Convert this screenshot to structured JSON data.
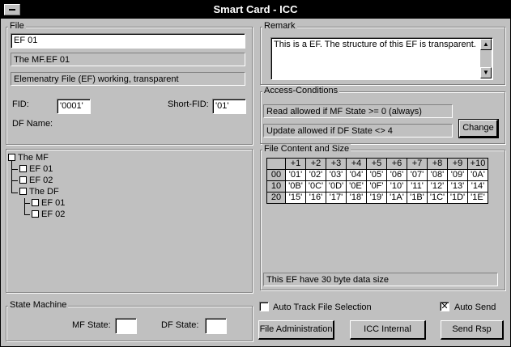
{
  "window": {
    "title": "Smart Card - ICC"
  },
  "file": {
    "group_label": "File",
    "name_value": "EF 01",
    "path": "The MF.EF 01",
    "type": "Elemenatry File (EF) working, transparent",
    "fid_label": "FID:",
    "fid_value": "'0001'",
    "short_fid_label": "Short-FID:",
    "short_fid_value": "'01'",
    "df_name_label": "DF Name:"
  },
  "remark": {
    "group_label": "Remark",
    "text": "This is a EF. The structure of this EF is transparent."
  },
  "access": {
    "group_label": "Access-Conditions",
    "read": "Read allowed if MF State >= 0 (always)",
    "update": "Update allowed if DF State <> 4",
    "change_label": "Change"
  },
  "tree": {
    "root": "The MF",
    "mf_ef1": "EF 01",
    "mf_ef2": "EF 02",
    "df": "The DF",
    "df_ef1": "EF 01",
    "df_ef2": "EF 02"
  },
  "content": {
    "group_label": "File Content and Size",
    "columns": [
      "+1",
      "+2",
      "+3",
      "+4",
      "+5",
      "+6",
      "+7",
      "+8",
      "+9",
      "+10"
    ],
    "rows": [
      {
        "offset": "00",
        "cells": [
          "'01'",
          "'02'",
          "'03'",
          "'04'",
          "'05'",
          "'06'",
          "'07'",
          "'08'",
          "'09'",
          "'0A'"
        ]
      },
      {
        "offset": "10",
        "cells": [
          "'0B'",
          "'0C'",
          "'0D'",
          "'0E'",
          "'0F'",
          "'10'",
          "'11'",
          "'12'",
          "'13'",
          "'14'"
        ]
      },
      {
        "offset": "20",
        "cells": [
          "'15'",
          "'16'",
          "'17'",
          "'18'",
          "'19'",
          "'1A'",
          "'1B'",
          "'1C'",
          "'1D'",
          "'1E'"
        ]
      }
    ],
    "size_text": "This EF have 30 byte data size"
  },
  "state": {
    "group_label": "State Machine",
    "mf_label": "MF State:",
    "df_label": "DF State:"
  },
  "options": {
    "auto_track_label": "Auto Track File Selection",
    "auto_track_checked": false,
    "auto_send_label": "Auto Send",
    "auto_send_checked": true,
    "auto_send_mark": "✕"
  },
  "buttons": {
    "file_admin": "File Administration",
    "icc_internal": "ICC Internal",
    "send_rsp": "Send Rsp"
  }
}
